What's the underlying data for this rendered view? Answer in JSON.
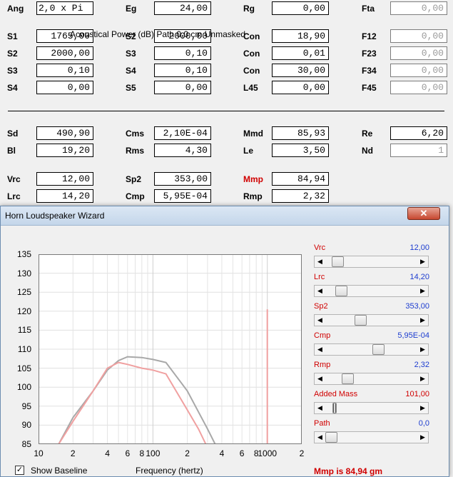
{
  "form": {
    "rows": [
      [
        {
          "label": "Ang",
          "value": "2,0 x Pi",
          "kind": "left"
        },
        {
          "label": "Eg",
          "value": "24,00"
        },
        {
          "label": "Rg",
          "value": "0,00"
        },
        {
          "label": "Fta",
          "value": "0,00",
          "kind": "grey"
        }
      ],
      [
        {
          "label": "S1",
          "value": "1765,00"
        },
        {
          "label": "S2",
          "value": "2000,00"
        },
        {
          "label": "Con",
          "value": "18,90"
        },
        {
          "label": "F12",
          "value": "0,00",
          "kind": "grey"
        }
      ],
      [
        {
          "label": "S2",
          "value": "2000,00"
        },
        {
          "label": "S3",
          "value": "0,10"
        },
        {
          "label": "Con",
          "value": "0,01"
        },
        {
          "label": "F23",
          "value": "0,00",
          "kind": "grey"
        }
      ],
      [
        {
          "label": "S3",
          "value": "0,10"
        },
        {
          "label": "S4",
          "value": "0,10"
        },
        {
          "label": "Con",
          "value": "30,00"
        },
        {
          "label": "F34",
          "value": "0,00",
          "kind": "grey"
        }
      ],
      [
        {
          "label": "S4",
          "value": "0,00"
        },
        {
          "label": "S5",
          "value": "0,00"
        },
        {
          "label": "L45",
          "value": "0,00"
        },
        {
          "label": "F45",
          "value": "0,00",
          "kind": "grey"
        }
      ],
      [
        {
          "label": "Sd",
          "value": "490,90"
        },
        {
          "label": "Cms",
          "value": "2,10E-04"
        },
        {
          "label": "Mmd",
          "value": "85,93"
        },
        {
          "label": "Re",
          "value": "6,20"
        }
      ],
      [
        {
          "label": "Bl",
          "value": "19,20"
        },
        {
          "label": "Rms",
          "value": "4,30"
        },
        {
          "label": "Le",
          "value": "3,50"
        },
        {
          "label": "Nd",
          "value": "1",
          "kind": "grey"
        }
      ],
      [
        {
          "label": "Vrc",
          "value": "12,00"
        },
        {
          "label": "Sp2",
          "value": "353,00"
        },
        {
          "label": "Mmp",
          "value": "84,94",
          "labelColor": "red"
        }
      ],
      [
        {
          "label": "Lrc",
          "value": "14,20"
        },
        {
          "label": "Cmp",
          "value": "5,95E-04"
        },
        {
          "label": "Rmp",
          "value": "2,32"
        }
      ]
    ]
  },
  "wizard": {
    "title": "Horn Loudspeaker Wizard",
    "close_label": "✕",
    "plot_title": "Acoustical Power (dB)   Path 0,0 cm   Unmasked",
    "x_label": "Frequency (hertz)",
    "show_baseline_label": "Show Baseline",
    "show_baseline_checked": "✓",
    "status": "Mmp is 84,94 gm",
    "sliders": [
      {
        "name": "Vrc",
        "value": "12,00",
        "level": 0.08
      },
      {
        "name": "Lrc",
        "value": "14,20",
        "level": 0.12
      },
      {
        "name": "Sp2",
        "value": "353,00",
        "level": 0.36
      },
      {
        "name": "Cmp",
        "value": "5,95E-04",
        "level": 0.58
      },
      {
        "name": "Rmp",
        "value": "2,32",
        "level": 0.2
      },
      {
        "name": "Added Mass",
        "value": "101,00",
        "level": 0.08,
        "grip": true
      },
      {
        "name": "Path",
        "value": "0,0",
        "level": 0.0,
        "blue_value": true
      }
    ]
  },
  "chart_data": {
    "type": "line",
    "title": "Acoustical Power (dB)   Path 0,0 cm   Unmasked",
    "xlabel": "Frequency (hertz)",
    "ylabel": "",
    "x_scale": "log",
    "xlim": [
      10,
      2000
    ],
    "ylim": [
      85,
      135
    ],
    "grid": true,
    "y_ticks": [
      85,
      90,
      95,
      100,
      105,
      110,
      115,
      120,
      125,
      130,
      135
    ],
    "x_tick_labels": [
      "10",
      "2",
      "4",
      "6",
      "8",
      "100",
      "2",
      "4",
      "6",
      "8",
      "1000",
      "2"
    ],
    "x_tick_values": [
      10,
      20,
      40,
      60,
      80,
      100,
      200,
      400,
      600,
      800,
      1000,
      2000
    ],
    "series": [
      {
        "color": "#a8a8a8",
        "x": [
          15,
          20,
          30,
          40,
          50,
          60,
          80,
          100,
          130,
          200,
          300,
          350
        ],
        "y": [
          85,
          92,
          99,
          104.5,
          107,
          108,
          107.8,
          107.3,
          106.5,
          99,
          89,
          85
        ]
      },
      {
        "color": "#f0a0a0",
        "x": [
          15,
          20,
          30,
          40,
          50,
          60,
          80,
          100,
          130,
          200,
          250,
          290
        ],
        "y": [
          85,
          91,
          99,
          105,
          106.5,
          106,
          105,
          104.5,
          103.5,
          94,
          89,
          85
        ]
      },
      {
        "color": "#f0a0a0",
        "x": [
          1000,
          1000
        ],
        "y": [
          85,
          120.5
        ]
      }
    ]
  }
}
